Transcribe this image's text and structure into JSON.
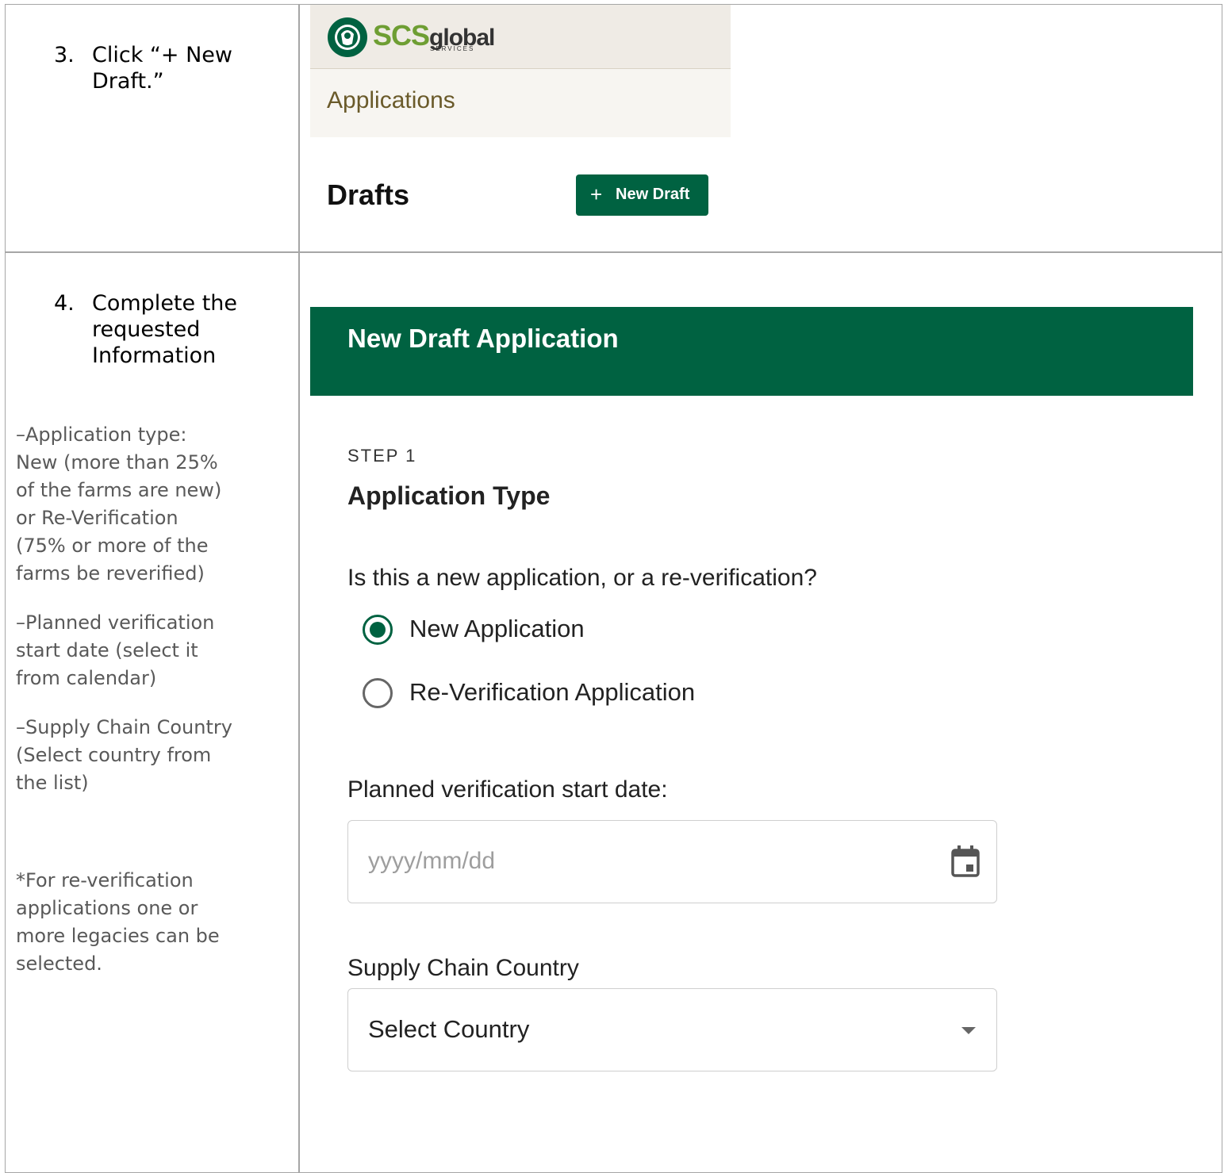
{
  "steps": {
    "three": {
      "num": "3.",
      "text": "Click “+ New\nDraft.”"
    },
    "four": {
      "num": "4.",
      "text": "Complete the\nrequested\nInformation"
    }
  },
  "notes": {
    "application_type": "–Application type:\nNew (more than 25%\nof the farms are new)\nor Re-Verification\n(75% or more of the\nfarms be reverified)",
    "start_date": "–Planned verification\nstart date (select it\nfrom calendar)",
    "country": "–Supply Chain Country\n(Select country from\nthe list)",
    "legacies": "*For re-verification\napplications one or\nmore legacies can be\nselected."
  },
  "portal": {
    "logo_text_scs": "SCS",
    "logo_text_global": "global",
    "logo_sub": "SERVICES",
    "nav_label": "Applications",
    "drafts_title": "Drafts",
    "new_draft_button": "New Draft"
  },
  "form": {
    "header": "New Draft Application",
    "step_label": "STEP 1",
    "step_title": "Application Type",
    "question": "Is this a new application, or a re-verification?",
    "options": [
      {
        "label": "New Application",
        "selected": true
      },
      {
        "label": "Re-Verification Application",
        "selected": false
      }
    ],
    "date_label": "Planned verification start date:",
    "date_placeholder": "yyyy/mm/dd",
    "country_label": "Supply Chain Country",
    "country_value": "Select Country"
  },
  "colors": {
    "brand_green": "#006241",
    "logo_green": "#6e9e33",
    "border": "#a6a6a6"
  },
  "icons": {
    "plus": "plus-icon",
    "calendar": "calendar-icon",
    "dropdown": "chevron-down-icon",
    "logo": "starbucks-siren-logo"
  }
}
